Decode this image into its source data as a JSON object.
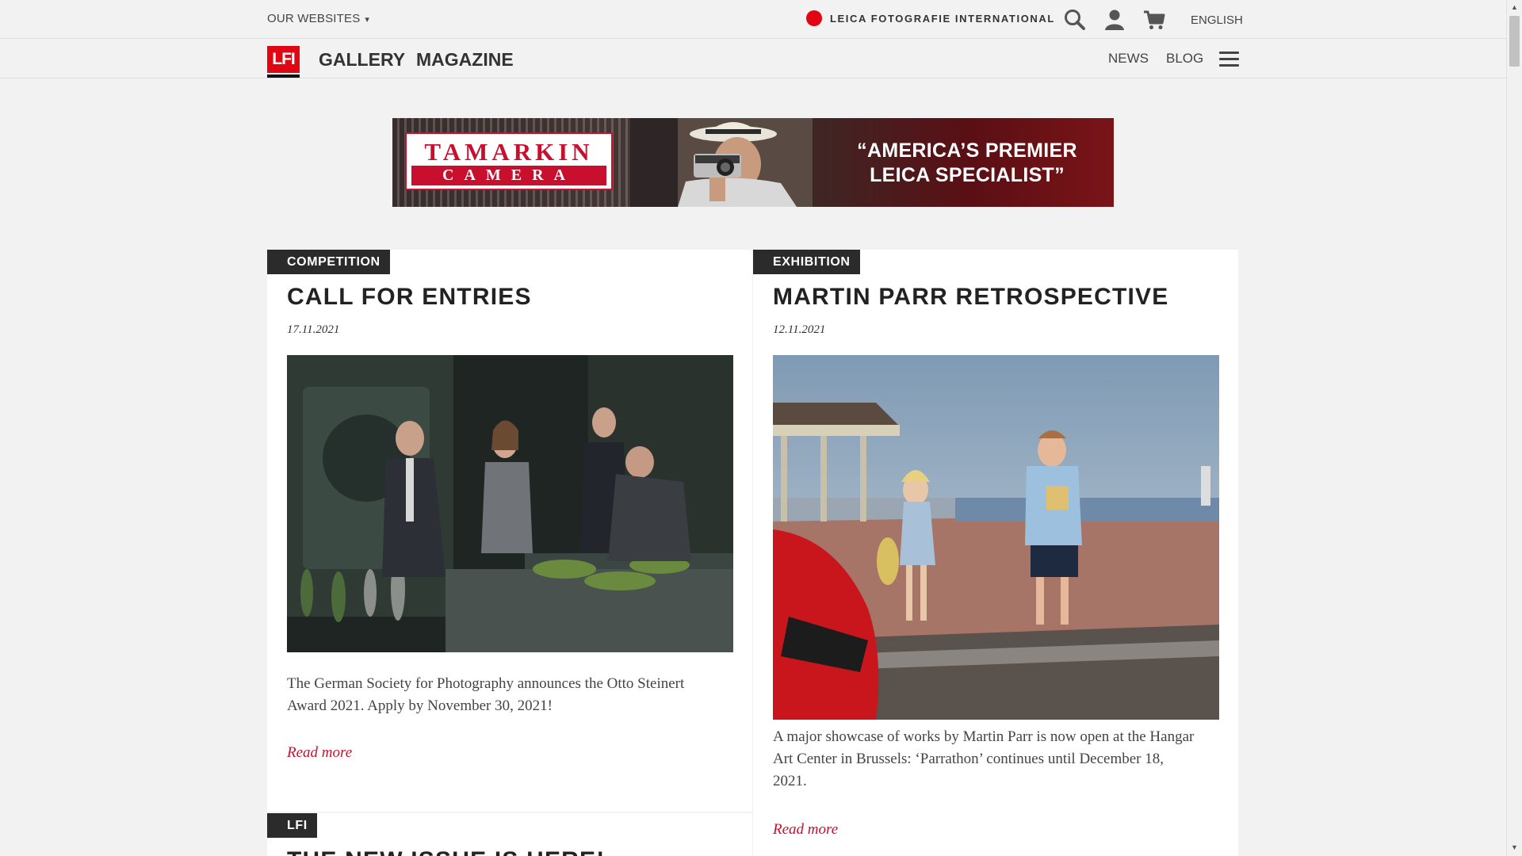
{
  "topbar": {
    "our_websites": "OUR WEBSITES",
    "caret": "▾",
    "lfi_international": "LEICA FOTOGRAFIE INTERNATIONAL",
    "language": "ENGLISH",
    "icons": [
      "leica-dot-icon",
      "search-icon",
      "user-icon",
      "cart-icon"
    ]
  },
  "nav": {
    "logo": "LFI",
    "main": [
      "GALLERY",
      "MAGAZINE"
    ],
    "right": [
      "NEWS",
      "BLOG"
    ],
    "menu_icon": "hamburger-menu-icon"
  },
  "banner": {
    "brand_top": "TAMARKIN",
    "brand_bottom": "CAMERA",
    "slogan_line1": "“AMERICA’S PREMIER",
    "slogan_line2": "LEICA SPECIALIST”"
  },
  "articles": [
    {
      "tag": "COMPETITION",
      "title": "CALL FOR ENTRIES",
      "date": "17.11.2021",
      "text": "The German Society for Photography announces the Otto Steinert Award 2021. Apply by November 30, 2021!",
      "read_more": "Read more"
    },
    {
      "tag": "EXHIBITION",
      "title": "MARTIN PARR RETROSPECTIVE",
      "date": "12.11.2021",
      "text": "A major showcase of works by Martin Parr is now open at the Hangar Art Center in Brussels: ‘Parrathon’ continues until December 18, 2021.",
      "read_more": "Read more"
    },
    {
      "tag": "LFI",
      "title": "THE NEW ISSUE IS HERE!"
    }
  ],
  "colors": {
    "accent_red": "#e20612",
    "link_red": "#c8102e",
    "tag_bg": "#2b2b2b",
    "page_bg": "#f2f2f2"
  }
}
